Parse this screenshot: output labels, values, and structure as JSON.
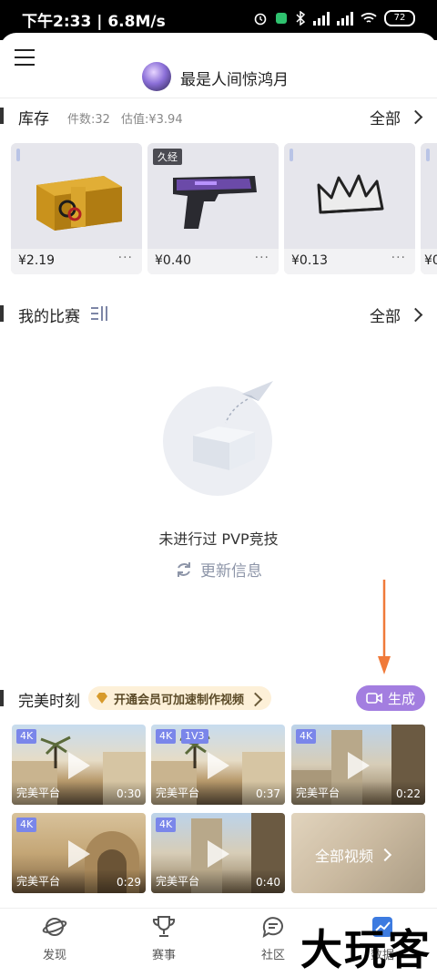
{
  "status_bar": {
    "time": "下午2:33 | 6.8M/s",
    "battery": "72"
  },
  "header": {
    "username": "最是人间惊鸿月"
  },
  "inventory": {
    "title": "库存",
    "count": "件数:32",
    "value": "估值:¥3.94",
    "all_label": "全部",
    "items": [
      {
        "price": "¥2.19",
        "wear": "",
        "icon": "weapon-case-icon"
      },
      {
        "price": "¥0.40",
        "wear": "久经",
        "icon": "pistol-icon"
      },
      {
        "price": "¥0.13",
        "wear": "",
        "icon": "crown-icon"
      },
      {
        "price": "¥0",
        "wear": "",
        "icon": "item-icon"
      }
    ],
    "more": "···"
  },
  "matches": {
    "title": "我的比赛",
    "all_label": "全部",
    "empty_text": "未进行过 PVP竞技",
    "refresh_label": "更新信息"
  },
  "moments": {
    "title": "完美时刻",
    "vip_text": "开通会员可加速制作视频",
    "generate_label": "生成",
    "videos": [
      {
        "badges": [
          "4K"
        ],
        "source": "完美平台",
        "duration": "0:30"
      },
      {
        "badges": [
          "4K",
          "1V3"
        ],
        "source": "完美平台",
        "duration": "0:37"
      },
      {
        "badges": [
          "4K"
        ],
        "source": "完美平台",
        "duration": "0:22"
      },
      {
        "badges": [
          "4K"
        ],
        "source": "完美平台",
        "duration": "0:29"
      },
      {
        "badges": [
          "4K"
        ],
        "source": "完美平台",
        "duration": "0:40"
      }
    ],
    "all_videos_label": "全部视频"
  },
  "bottom_nav": {
    "items": [
      {
        "label": "发现"
      },
      {
        "label": "赛事"
      },
      {
        "label": "社区"
      },
      {
        "label": "数据"
      }
    ]
  },
  "watermark": "大玩客",
  "colors": {
    "accent_purple": "#a37ee0",
    "badge_blue": "#7a86ea",
    "arrow_orange": "#f07a3a",
    "vip_bg": "#fdf0d8"
  }
}
